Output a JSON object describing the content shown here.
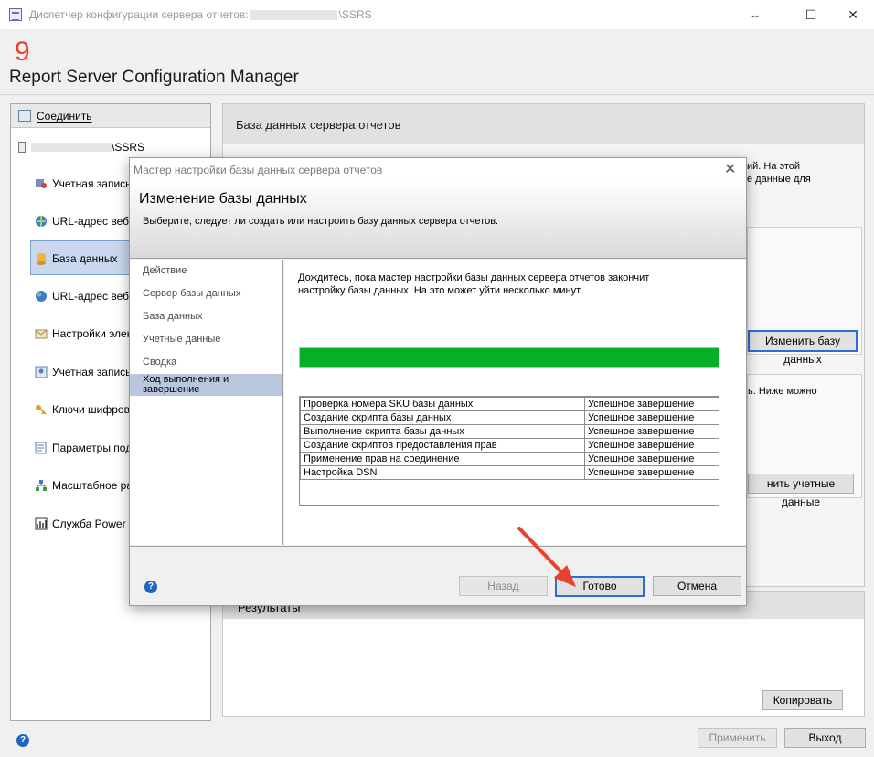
{
  "window": {
    "title_prefix": "Диспетчер конфигурации сервера отчетов:",
    "title_suffix": "\\SSRS",
    "controls": {
      "resize": "↔",
      "minimize": "—",
      "maximize": "☐",
      "close": "✕"
    }
  },
  "annotation": {
    "step_number": "9"
  },
  "header": {
    "title": "Report Server Configuration Manager"
  },
  "sidebar": {
    "connect_label": "Соединить",
    "server_suffix": "\\SSRS",
    "items": [
      {
        "label": "Учетная запись с",
        "icon": "service-account-icon"
      },
      {
        "label": "URL-адрес веб-сл",
        "icon": "web-service-url-icon"
      },
      {
        "label": "База данных",
        "icon": "database-icon",
        "selected": true
      },
      {
        "label": "URL-адрес веб-по",
        "icon": "web-portal-url-icon"
      },
      {
        "label": "Настройки элект",
        "icon": "email-settings-icon"
      },
      {
        "label": "Учетная запись в",
        "icon": "execution-account-icon"
      },
      {
        "label": "Ключи шифрован",
        "icon": "encryption-keys-icon"
      },
      {
        "label": "Параметры подп",
        "icon": "subscription-settings-icon"
      },
      {
        "label": "Масштабное раз",
        "icon": "scale-out-icon"
      },
      {
        "label": "Служба Power BI",
        "icon": "power-bi-icon"
      }
    ]
  },
  "content": {
    "section_title": "База данных сервера отчетов",
    "text_line1": "ий. На этой",
    "text_line2": "е данные для",
    "change_db_button": "Изменить базу данных",
    "text_line3": "ь. Ниже можно",
    "change_credentials_button": "нить учетные данные",
    "results_title": "Результаты",
    "copy_button": "Копировать"
  },
  "bottom": {
    "apply_button": "Применить",
    "exit_button": "Выход"
  },
  "dialog": {
    "title": "Мастер настройки базы данных сервера отчетов",
    "heading": "Изменение базы данных",
    "subheading": "Выберите, следует ли создать или настроить базу данных сервера отчетов.",
    "steps": [
      "Действие",
      "Сервер базы данных",
      "База данных",
      "Учетные данные",
      "Сводка",
      "Ход выполнения и завершение"
    ],
    "wait_text": "Дождитесь, пока мастер настройки базы данных сервера отчетов закончит настройку базы данных. На это может уйти несколько минут.",
    "progress_percent": 100,
    "tasks": [
      {
        "task": "Проверка номера SKU базы данных",
        "status": "Успешное завершение"
      },
      {
        "task": "Создание скрипта базы данных",
        "status": "Успешное завершение"
      },
      {
        "task": "Выполнение скрипта базы данных",
        "status": "Успешное завершение"
      },
      {
        "task": "Создание скриптов предоставления прав",
        "status": "Успешное завершение"
      },
      {
        "task": "Применение прав на соединение",
        "status": "Успешное завершение"
      },
      {
        "task": "Настройка DSN",
        "status": "Успешное завершение"
      }
    ],
    "back_button": "Назад",
    "finish_button": "Готово",
    "cancel_button": "Отмена"
  },
  "colors": {
    "progress": "#06b025",
    "annotation": "#e8412f",
    "focus": "#2d6fd1"
  }
}
